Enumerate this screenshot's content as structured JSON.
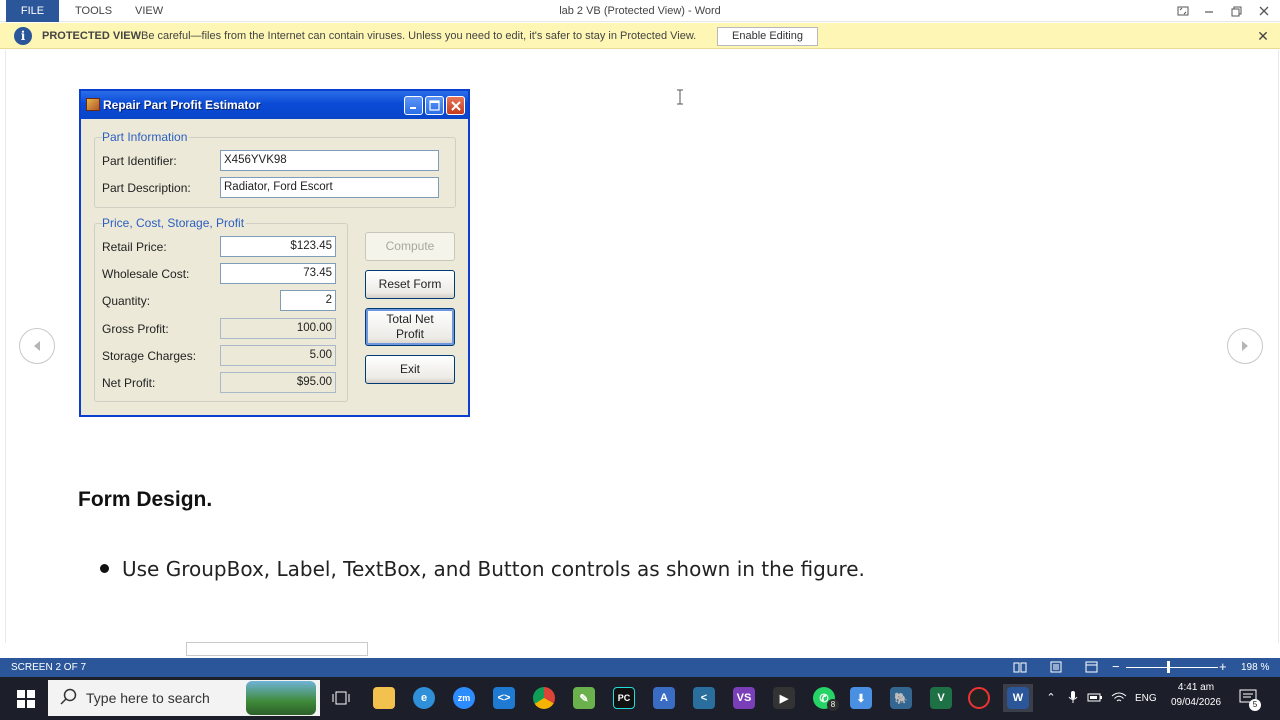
{
  "titlebar": {
    "menu": [
      "FILE",
      "TOOLS",
      "VIEW"
    ],
    "window_title": "lab 2 VB (Protected View) - Word"
  },
  "protected_view": {
    "title": "PROTECTED VIEW",
    "message": "Be careful—files from the Internet can contain viruses. Unless you need to edit, it's safer to stay in Protected View.",
    "enable_button": "Enable Editing"
  },
  "figure": {
    "title": "Repair Part Profit Estimator",
    "group1_title": "Part Information",
    "group2_title": "Price, Cost, Storage, Profit",
    "fields": [
      {
        "label": "Part Identifier:",
        "value": "X456YVK98"
      },
      {
        "label": "Part Description:",
        "value": "Radiator, Ford Escort"
      },
      {
        "label": "Retail Price:",
        "value": "$123.45"
      },
      {
        "label": "Wholesale Cost:",
        "value": "73.45"
      },
      {
        "label": "Quantity:",
        "value": "2"
      },
      {
        "label": "Gross Profit:",
        "value": "100.00"
      },
      {
        "label": "Storage Charges:",
        "value": "5.00"
      },
      {
        "label": "Net Profit:",
        "value": "$95.00"
      }
    ],
    "buttons": {
      "compute": "Compute",
      "reset": "Reset Form",
      "total_line1": "Total Net",
      "total_line2": "Profit",
      "exit": "Exit"
    }
  },
  "document": {
    "heading": "Form Design.",
    "bullet": "Use GroupBox, Label, TextBox, and Button controls as shown in the figure."
  },
  "statusbar": {
    "screen": "SCREEN 2 OF 7",
    "zoom": "198 %",
    "zoom_level_percent": 198
  },
  "taskbar": {
    "search_placeholder": "Type here to search",
    "language": "ENG",
    "time": "4:41 am",
    "date": "09/04/2026",
    "notification_count": "5",
    "whatsapp_badge": "8"
  }
}
